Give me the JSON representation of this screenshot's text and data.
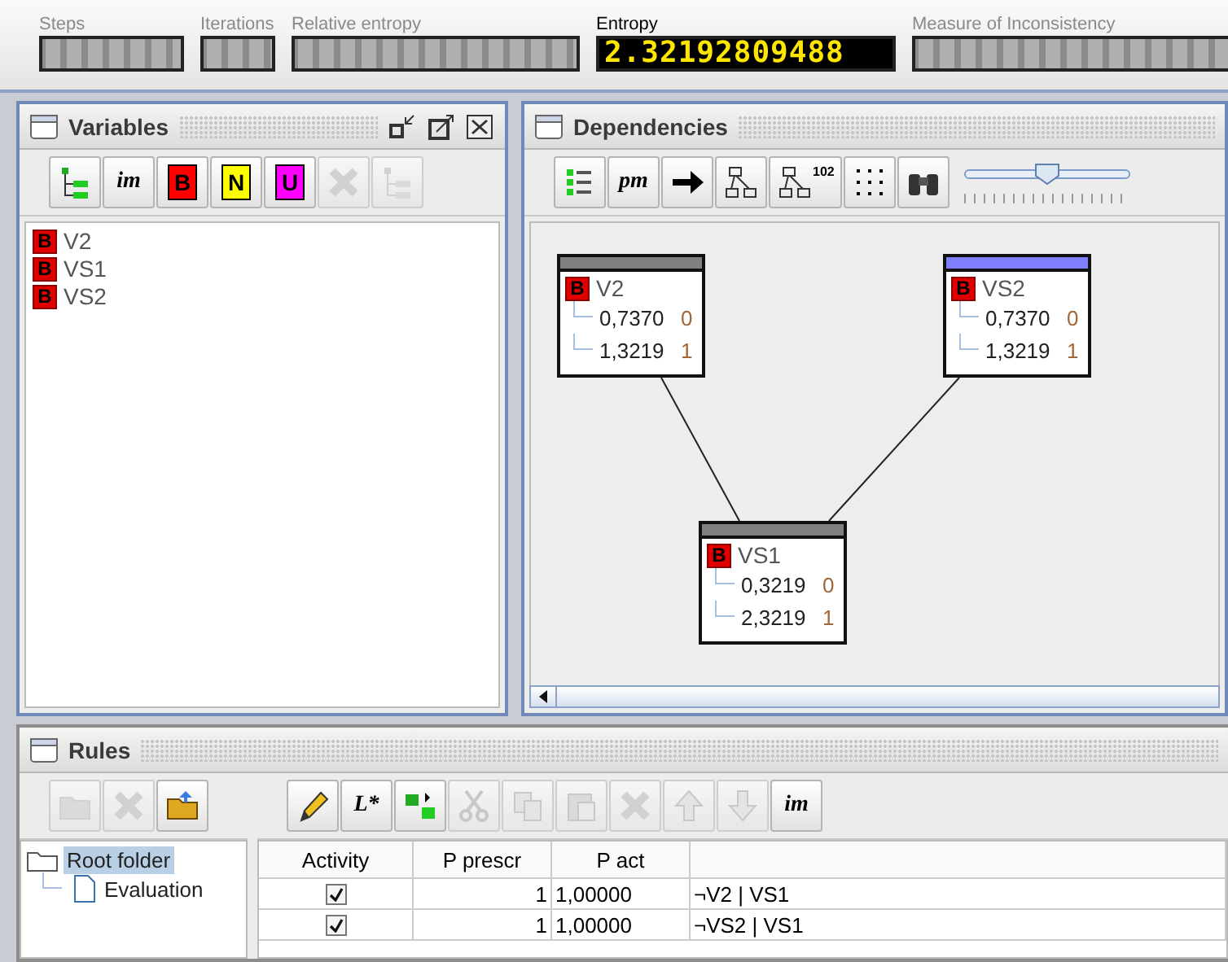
{
  "meters": [
    {
      "label": "Steps",
      "lit": false
    },
    {
      "label": "Iterations",
      "lit": false
    },
    {
      "label": "Relative entropy",
      "lit": false
    },
    {
      "label": "Entropy",
      "lit": true,
      "value": "2.32192809488"
    },
    {
      "label": "Measure of Inconsistency",
      "lit": false
    }
  ],
  "variables": {
    "title": "Variables",
    "toolbar": [
      {
        "kind": "tree",
        "disabled": false
      },
      {
        "kind": "text",
        "label": "im",
        "disabled": false
      },
      {
        "kind": "new-var",
        "label": "B",
        "color": "#ff0000",
        "disabled": false
      },
      {
        "kind": "new-var",
        "label": "N",
        "color": "#ffff00",
        "disabled": false
      },
      {
        "kind": "new-var",
        "label": "U",
        "color": "#ff00ff",
        "disabled": false
      },
      {
        "kind": "delete",
        "disabled": true
      },
      {
        "kind": "tree",
        "disabled": true
      }
    ],
    "items": [
      {
        "type": "B",
        "name": "V2"
      },
      {
        "type": "B",
        "name": "VS1"
      },
      {
        "type": "B",
        "name": "VS2"
      }
    ]
  },
  "dependencies": {
    "title": "Dependencies",
    "toolbar": [
      {
        "kind": "var-list",
        "disabled": false
      },
      {
        "kind": "text",
        "label": "pm",
        "disabled": false
      },
      {
        "kind": "arrow",
        "disabled": false
      },
      {
        "kind": "layout",
        "disabled": false
      },
      {
        "kind": "layout",
        "label": "102",
        "disabled": false
      },
      {
        "kind": "dots",
        "disabled": false
      },
      {
        "kind": "binoculars",
        "disabled": false
      }
    ],
    "zoom_slider": {
      "level": 0.5
    },
    "graph": {
      "type": "B",
      "name": "VS1",
      "selected": false,
      "rows": [
        {
          "value": "0,3219",
          "state": "0"
        },
        {
          "value": "2,3219",
          "state": "1"
        }
      ],
      "children": [
        {
          "type": "B",
          "name": "V2",
          "selected": false,
          "rows": [
            {
              "value": "0,7370",
              "state": "0"
            },
            {
              "value": "1,3219",
              "state": "1"
            }
          ]
        },
        {
          "type": "B",
          "name": "VS2",
          "selected": true,
          "rows": [
            {
              "value": "0,7370",
              "state": "0"
            },
            {
              "value": "1,3219",
              "state": "1"
            }
          ]
        }
      ]
    }
  },
  "rules": {
    "title": "Rules",
    "folder_toolbar": [
      {
        "kind": "folder",
        "disabled": true
      },
      {
        "kind": "delete",
        "disabled": true
      },
      {
        "kind": "folder-open",
        "disabled": false
      }
    ],
    "rule_toolbar": [
      {
        "kind": "pencil",
        "disabled": false
      },
      {
        "kind": "text",
        "label": "L*",
        "disabled": false
      },
      {
        "kind": "transfer",
        "disabled": false
      },
      {
        "kind": "scissors",
        "disabled": true
      },
      {
        "kind": "copy",
        "disabled": true
      },
      {
        "kind": "paste",
        "disabled": true
      },
      {
        "kind": "delete",
        "disabled": true
      },
      {
        "kind": "up",
        "disabled": true
      },
      {
        "kind": "down",
        "disabled": true
      },
      {
        "kind": "text",
        "label": "im",
        "disabled": false
      }
    ],
    "tree": [
      {
        "label": "Root folder",
        "selected": true,
        "children": [
          {
            "label": "Evaluation",
            "selected": false
          }
        ]
      }
    ],
    "columns": [
      "Activity",
      "P prescr",
      "P act"
    ],
    "rows": [
      {
        "active": true,
        "p_prescr": "1",
        "p_act": "1,00000",
        "rule": "¬V2 | VS1"
      },
      {
        "active": true,
        "p_prescr": "1",
        "p_act": "1,00000",
        "rule": "¬VS2 | VS1"
      }
    ]
  }
}
